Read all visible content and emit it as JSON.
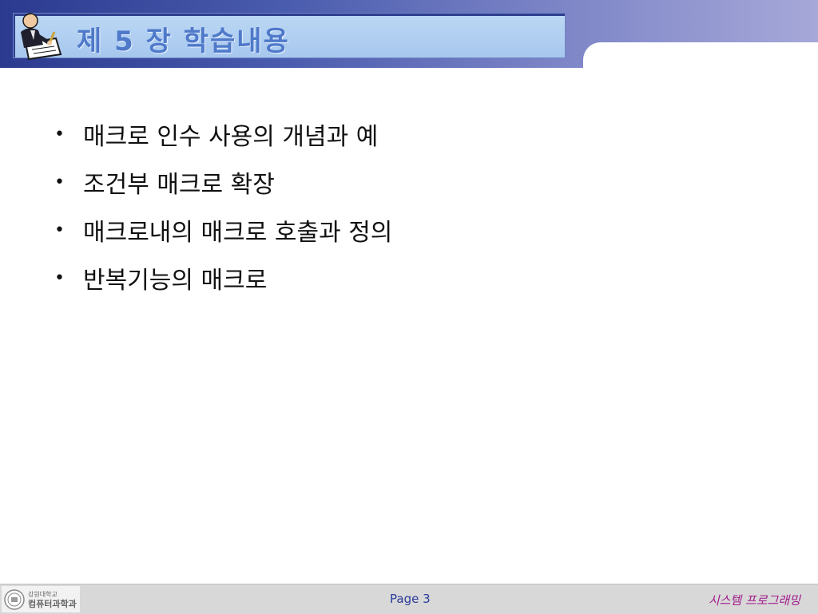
{
  "slide": {
    "title": "제 5 장 학습내용",
    "bullets": [
      "매크로 인수 사용의 개념과 예",
      "조건부 매크로 확장",
      "매크로내의 매크로 호출과 정의",
      "반복기능의 매크로"
    ],
    "bullet_symbol": "•"
  },
  "footer": {
    "logo_university": "강원대학교",
    "logo_department": "컴퓨터과학과",
    "page": "Page 3",
    "course": "시스템 프로그래밍"
  },
  "icons": {
    "title_icon": "writer-clipart-icon",
    "logo_icon": "university-seal-icon"
  },
  "colors": {
    "header_start": "#2b3a8f",
    "header_end": "#a6a8d8",
    "title_box": "#a7c7ee",
    "title_text": "#4f79c9",
    "page_text": "#2a3a99",
    "course_text": "#a1198a"
  }
}
